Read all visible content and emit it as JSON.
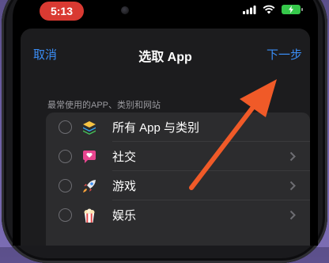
{
  "status_bar": {
    "time": "5:13",
    "icons": [
      "cellular-signal-icon",
      "wifi-icon",
      "battery-charging-icon"
    ]
  },
  "nav": {
    "cancel": "取消",
    "title": "选取 App",
    "next": "下一步"
  },
  "section_header": "最常使用的APP、类别和网站",
  "rows": [
    {
      "label": "所有 App 与类别",
      "icon": "all-apps-stack-icon",
      "chevron": false
    },
    {
      "label": "社交",
      "icon": "social-chat-icon",
      "chevron": true
    },
    {
      "label": "游戏",
      "icon": "games-rocket-icon",
      "chevron": true
    },
    {
      "label": "娱乐",
      "icon": "entertainment-popcorn-icon",
      "chevron": true
    }
  ],
  "colors": {
    "accent": "#3a8df5",
    "annotation_arrow": "#f05a28",
    "time_pill": "#d93a32"
  }
}
